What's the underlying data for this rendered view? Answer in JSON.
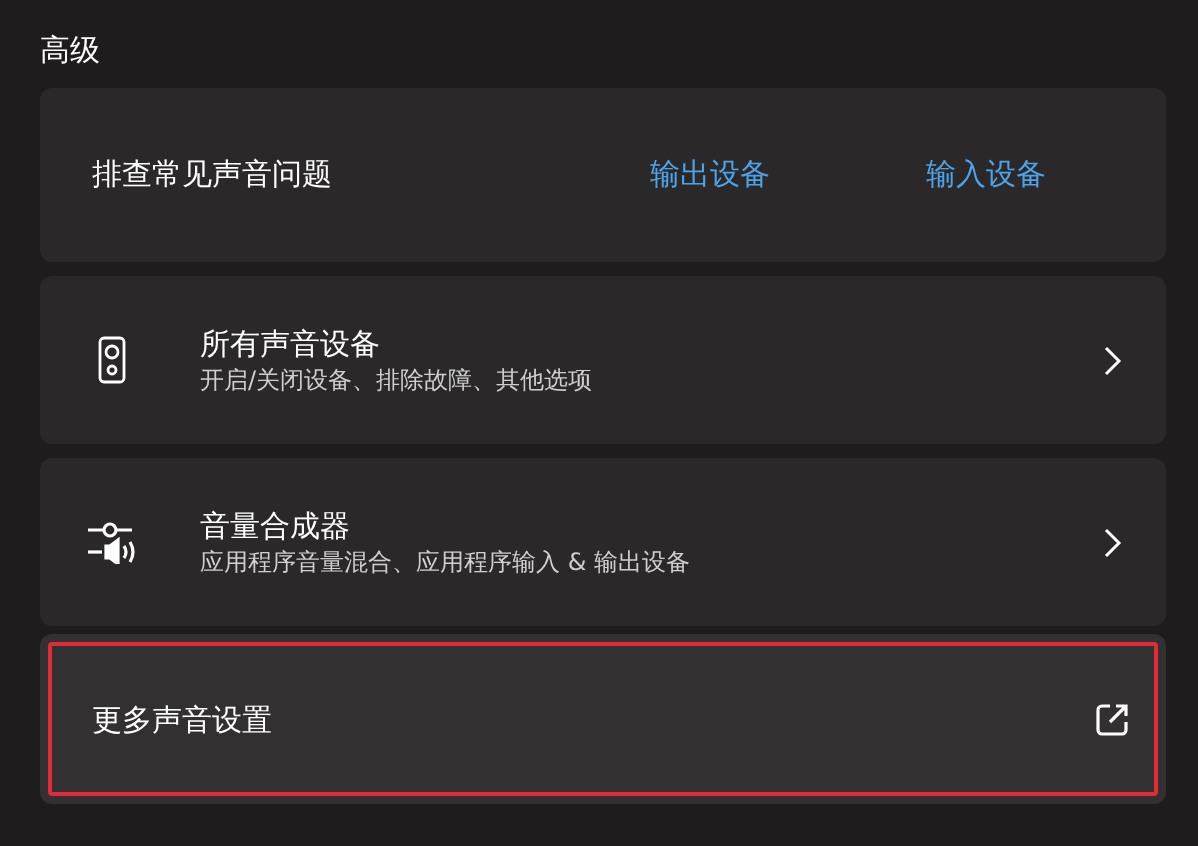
{
  "section_title": "高级",
  "troubleshoot": {
    "label": "排查常见声音问题",
    "links": [
      "输出设备",
      "输入设备"
    ]
  },
  "items": [
    {
      "kind": "nav",
      "title": "所有声音设备",
      "subtitle": "开启/关闭设备、排除故障、其他选项",
      "highlighted": false
    },
    {
      "kind": "nav",
      "title": "音量合成器",
      "subtitle": "应用程序音量混合、应用程序输入 & 输出设备",
      "highlighted": false
    },
    {
      "kind": "external",
      "title": "更多声音设置",
      "highlighted": true
    }
  ]
}
